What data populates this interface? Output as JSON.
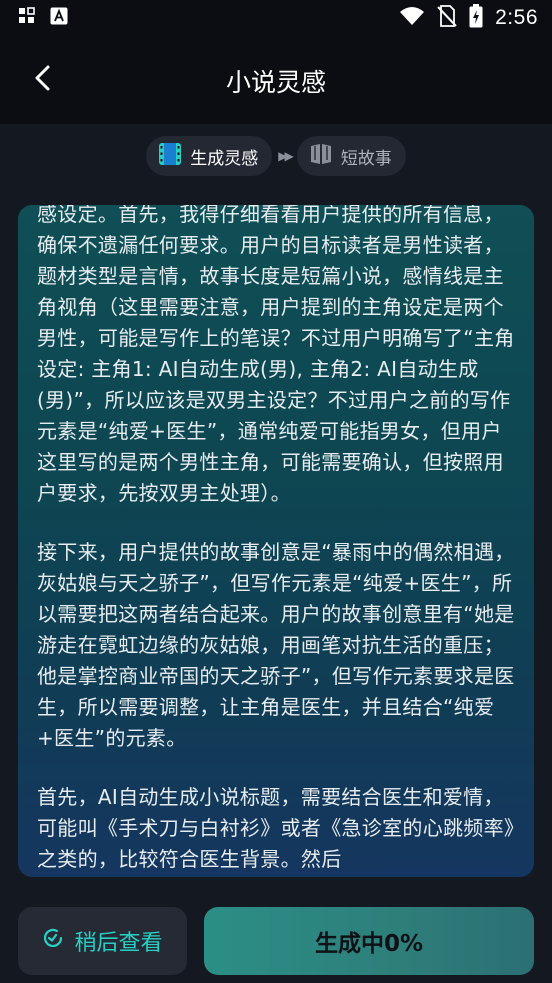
{
  "status_bar": {
    "time": "2:56",
    "icons": [
      "grid-icon",
      "a-notification-icon",
      "wifi-icon",
      "no-sim-icon",
      "battery-charging-icon"
    ]
  },
  "header": {
    "title": "小说灵感",
    "back_icon": "chevron-left-icon"
  },
  "steps": [
    {
      "label": "生成灵感",
      "icon": "film-icon",
      "active": true
    },
    {
      "label": "短故事",
      "icon": "book-icon",
      "active": false
    }
  ],
  "story": {
    "paragraphs": [
      "感设定。首先，我得仔细看看用户提供的所有信息，确保不遗漏任何要求。用户的目标读者是男性读者，题材类型是言情，故事长度是短篇小说，感情线是主角视角（这里需要注意，用户提到的主角设定是两个男性，可能是写作上的笔误？不过用户明确写了“主角设定: 主角1: AI自动生成(男), 主角2: AI自动生成(男)”，所以应该是双男主设定？不过用户之前的写作元素是“纯爱+医生”，通常纯爱可能指男女，但用户这里写的是两个男性主角，可能需要确认，但按照用户要求，先按双男主处理）。",
      "接下来，用户提供的故事创意是“暴雨中的偶然相遇，灰姑娘与天之骄子”，但写作元素是“纯爱+医生”，所以需要把这两者结合起来。用户的故事创意里有“她是游走在霓虹边缘的灰姑娘，用画笔对抗生活的重压；他是掌控商业帝国的天之骄子”，但写作元素要求是医生，所以需要调整，让主角是医生，并且结合“纯爱+医生”的元素。",
      "首先，AI自动生成小说标题，需要结合医生和爱情，可能叫《手术刀与白衬衫》或者《急诊室的心跳频率》之类的，比较符合医生背景。然后"
    ]
  },
  "buttons": {
    "later_label": "稍后查看",
    "later_icon": "clock-icon",
    "generate_label": "生成中0%"
  },
  "colors": {
    "accent": "#27d0c4",
    "background": "#0b0d12",
    "card_top": "#0f4f55",
    "card_bottom": "#153660"
  }
}
